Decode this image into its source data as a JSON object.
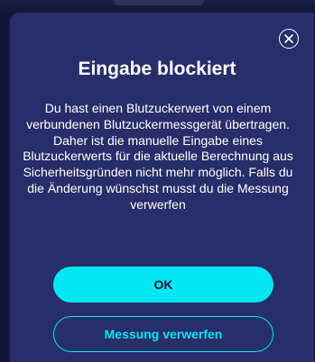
{
  "dialog": {
    "title": "Eingabe blockiert",
    "message": "Du hast einen Blutzuckerwert von einem verbundenen Blutzuckermessgerät übertragen. Daher ist die manuelle Eingabe eines Blutzuckerwerts für die aktuelle Berechnung aus Sicherheitsgründen nicht mehr möglich. Falls du die Änderung wünschst musst du die Messung verwerfen",
    "ok_label": "OK",
    "discard_label": "Messung verwerfen",
    "close_icon": "close-circle-icon"
  },
  "colors": {
    "backdrop": "#10163a",
    "dialog_bg": "#272e69",
    "accent": "#00e7f2",
    "text": "#ffffff"
  }
}
